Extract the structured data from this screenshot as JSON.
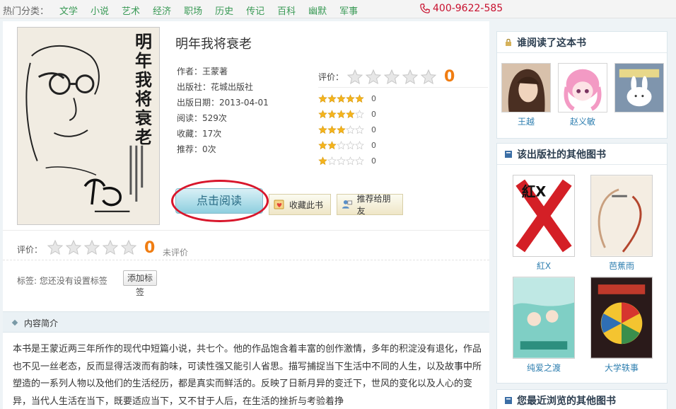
{
  "topbar": {
    "hot_label": "热门分类：",
    "categories": [
      "文学",
      "小说",
      "艺术",
      "经济",
      "职场",
      "历史",
      "传记",
      "百科",
      "幽默",
      "军事"
    ],
    "phone": "400-9622-585",
    "link_color": "#3a9a56"
  },
  "book": {
    "title": "明年我将衰老",
    "author": "作者：王蒙著",
    "publisher": "出版社：花城出版社",
    "pub_date": "出版日期：2013-04-01",
    "reads": "阅读：529次",
    "favorites": "收藏：17次",
    "recommends": "推荐：0次",
    "cover_title": "明年我将衰老"
  },
  "rating": {
    "label": "评价：",
    "score": "0",
    "stars_filled": 0,
    "distribution": [
      {
        "stars": 5,
        "count": "0"
      },
      {
        "stars": 4,
        "count": "0"
      },
      {
        "stars": 3,
        "count": "0"
      },
      {
        "stars": 2,
        "count": "0"
      },
      {
        "stars": 1,
        "count": "0"
      }
    ],
    "accent_color": "#f07d12"
  },
  "actions": {
    "read": "点击阅读",
    "favorite": "收藏此书",
    "recommend": "推荐给朋友"
  },
  "my_rating": {
    "label": "评价：",
    "score": "0",
    "note": "未评价"
  },
  "tags": {
    "text": "标签: 您还没有设置标签",
    "add_button": "添加标签"
  },
  "intro": {
    "title": "内容简介",
    "text": "本书是王蒙近两三年所作的现代中短篇小说，共七个。他的作品饱含着丰富的创作激情，多年的积淀没有退化，作品也不见一丝老态，反而显得活泼而有韵味，可读性强又能引人省思。描写捕捉当下生活中不同的人生，以及故事中所塑造的一系列人物以及他们的生活经历，都是真实而鲜活的。反映了日新月异的变迁下，世风的变化以及人心的变异，当代人生活在当下，既要适应当下，又不甘于人后，在生活的挫折与考验着挣"
  },
  "sidebar": {
    "readers_title": "谁阅读了这本书",
    "readers": [
      {
        "name": "王越",
        "icon": "avatar-long-hair"
      },
      {
        "name": "赵义敏",
        "icon": "avatar-anime-girl"
      },
      {
        "name": "",
        "icon": "avatar-bunny"
      }
    ],
    "publisher_title": "该出版社的其他图书",
    "publisher_books": [
      {
        "name": "紅X"
      },
      {
        "name": "芭蕉雨"
      },
      {
        "name": "纯爱之渡"
      },
      {
        "name": "大学轶事"
      }
    ],
    "recent_title": "您最近浏览的其他图书"
  }
}
